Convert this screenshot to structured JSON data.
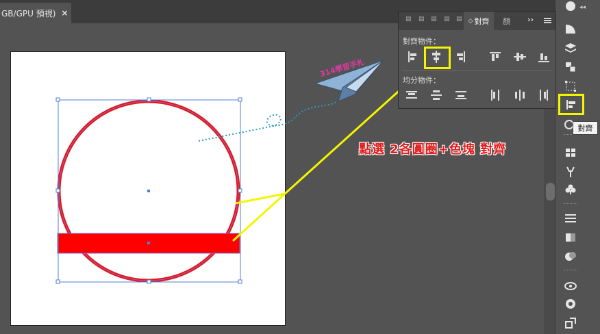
{
  "document_tab": {
    "title": "GB/GPU 預視)",
    "close_label": "×"
  },
  "align_panel": {
    "active_tab": "對齊",
    "extra_tab": "顏",
    "more_label": "››",
    "align_objects_label": "對齊物件：",
    "distribute_objects_label": "均分物件：",
    "align_buttons": [
      {
        "icon": "align-left-edges-icon"
      },
      {
        "icon": "align-horizontal-centers-icon",
        "highlighted": true
      },
      {
        "icon": "align-right-edges-icon"
      },
      {
        "icon": "align-top-edges-icon"
      },
      {
        "icon": "align-vertical-centers-icon"
      },
      {
        "icon": "align-bottom-edges-icon"
      }
    ],
    "distribute_buttons": [
      {
        "icon": "distribute-top-icon"
      },
      {
        "icon": "distribute-vertical-centers-icon"
      },
      {
        "icon": "distribute-bottom-icon"
      },
      {
        "icon": "distribute-left-icon"
      },
      {
        "icon": "distribute-horizontal-centers-icon"
      },
      {
        "icon": "distribute-right-icon"
      }
    ]
  },
  "side_toolbar": {
    "tooltip": "對齊",
    "tools": [
      "appearance-icon",
      "gradient-swatch-icon",
      "layers-icon",
      "artboards-icon",
      "transform-icon",
      "align-icon",
      "pathfinder-icon",
      "swatches-icon",
      "brushes-icon",
      "symbols-icon",
      "stroke-icon",
      "gradient-icon",
      "transparency-icon",
      "cc-libraries-icon",
      "color-guide-icon",
      "asset-export-icon"
    ]
  },
  "annotation": {
    "instruction": "點選  2各圓圈+色塊  對齊",
    "watermark": "314學習手札"
  },
  "colors": {
    "highlight": "#f5f500",
    "shape_red": "#ff0000",
    "selection": "#4f7fd6",
    "path_dots": "#2a9ac8"
  }
}
